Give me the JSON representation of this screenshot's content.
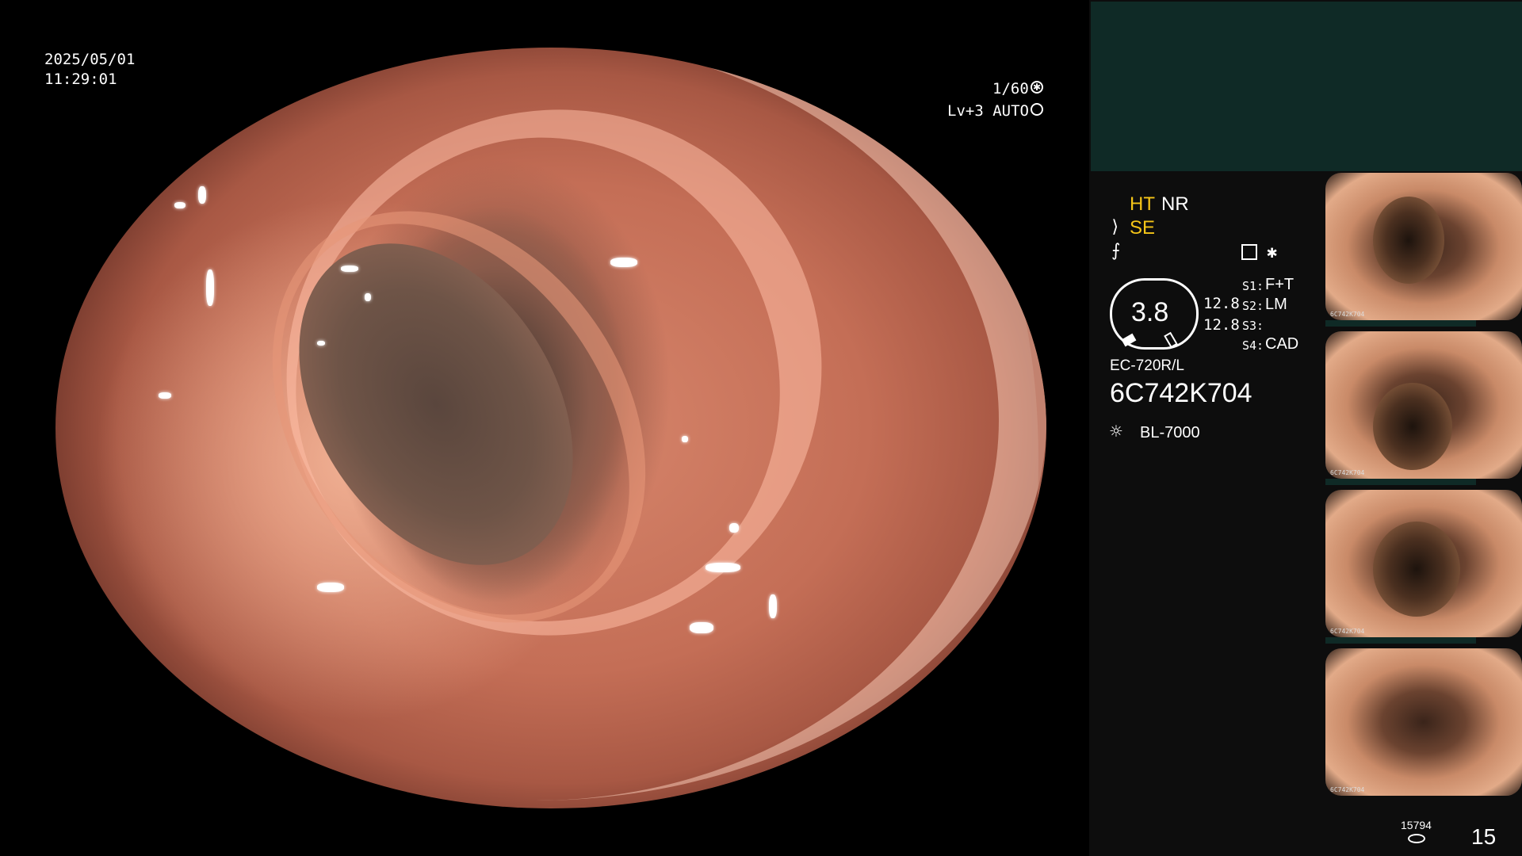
{
  "overlay": {
    "date": "2025/05/01",
    "time": "11:29:01",
    "shutter": "1/60",
    "level_mode": "Lv+3 AUTO"
  },
  "settings": {
    "ht": "HT",
    "nr": "NR",
    "se": "SE",
    "s1_label": "S1:",
    "s1_value": "F+T",
    "s2_label": "S2:",
    "s2_value": "LM",
    "s3_label": "S3:",
    "s3_value": "",
    "s4_label": "S4:",
    "s4_value": "CAD",
    "zoom_value": "3.8",
    "value_a": "12.8",
    "value_b": "12.8"
  },
  "scope": {
    "model": "EC-720R/L",
    "serial": "6C742K704",
    "light_source": "BL-7000"
  },
  "thumbnails": [
    {
      "code": "6C742K704"
    },
    {
      "code": "6C742K704"
    },
    {
      "code": "6C742K704"
    },
    {
      "code": "6C742K704"
    }
  ],
  "footer": {
    "storage_count": "15794",
    "image_count": "15"
  },
  "colors": {
    "background": "#000000",
    "info_box": "#0f2a26",
    "highlight_yellow": "#f5c518",
    "text": "#ffffff"
  },
  "icons": [
    "shutter-icon",
    "auto-iris-icon",
    "scope-bend-icon",
    "freeze-icon",
    "menu-icon",
    "asterisk-icon",
    "light-source-icon",
    "storage-icon"
  ]
}
